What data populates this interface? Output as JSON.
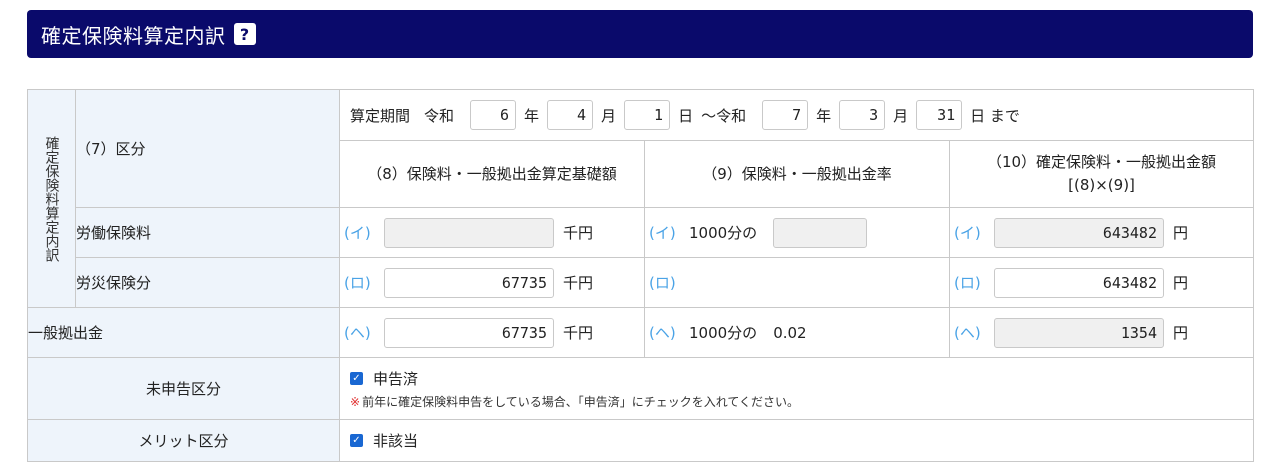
{
  "header": {
    "title": "確定保険料算定内訳",
    "help_label": "?"
  },
  "table": {
    "section_label": "確定保険料算定内訳",
    "kubun_label": "（7）区分",
    "period": {
      "label": "算定期間",
      "era_start": "令和",
      "start_year": "6",
      "year_unit": "年",
      "start_month": "4",
      "month_unit": "月",
      "start_day": "1",
      "day_unit": "日",
      "separator": "～令和",
      "end_year": "7",
      "end_month": "3",
      "end_day": "31",
      "until": "日 まで"
    },
    "col8_header": "（8）保険料・一般拠出金算定基礎額",
    "col9_header": "（9）保険料・一般拠出金率",
    "col10_header_line1": "（10）確定保険料・一般拠出金額",
    "col10_header_line2": "[(8)×(9)]",
    "rows": [
      {
        "label": "労働保険料",
        "mark": "(イ)",
        "base_value": "",
        "unit_thousand_yen": "千円",
        "rate_prefix": "1000分の",
        "rate_value": "",
        "amount_value": "643482",
        "unit_yen": "円"
      },
      {
        "label": "労災保険分",
        "mark": "(ロ)",
        "base_value": "67735",
        "unit_thousand_yen": "千円",
        "amount_value": "643482",
        "unit_yen": "円"
      },
      {
        "label": "一般拠出金",
        "mark": "(ヘ)",
        "base_value": "67735",
        "unit_thousand_yen": "千円",
        "rate_prefix": "1000分の",
        "rate_value": "0.02",
        "amount_value": "1354",
        "unit_yen": "円"
      }
    ],
    "mishinkoku": {
      "label": "未申告区分",
      "checkbox_label": "申告済",
      "checked": true,
      "note_mark": "※",
      "note": "前年に確定保険料申告をしている場合、「申告済」にチェックを入れてください。"
    },
    "merit": {
      "label": "メリット区分",
      "checkbox_label": "非該当",
      "checked": true
    }
  },
  "colors": {
    "header_bg": "#0a0a6b",
    "label_bg": "#eef4fb",
    "mark": "#4aa3e6",
    "checkbox": "#1967d2",
    "note_mark": "#e03030"
  }
}
